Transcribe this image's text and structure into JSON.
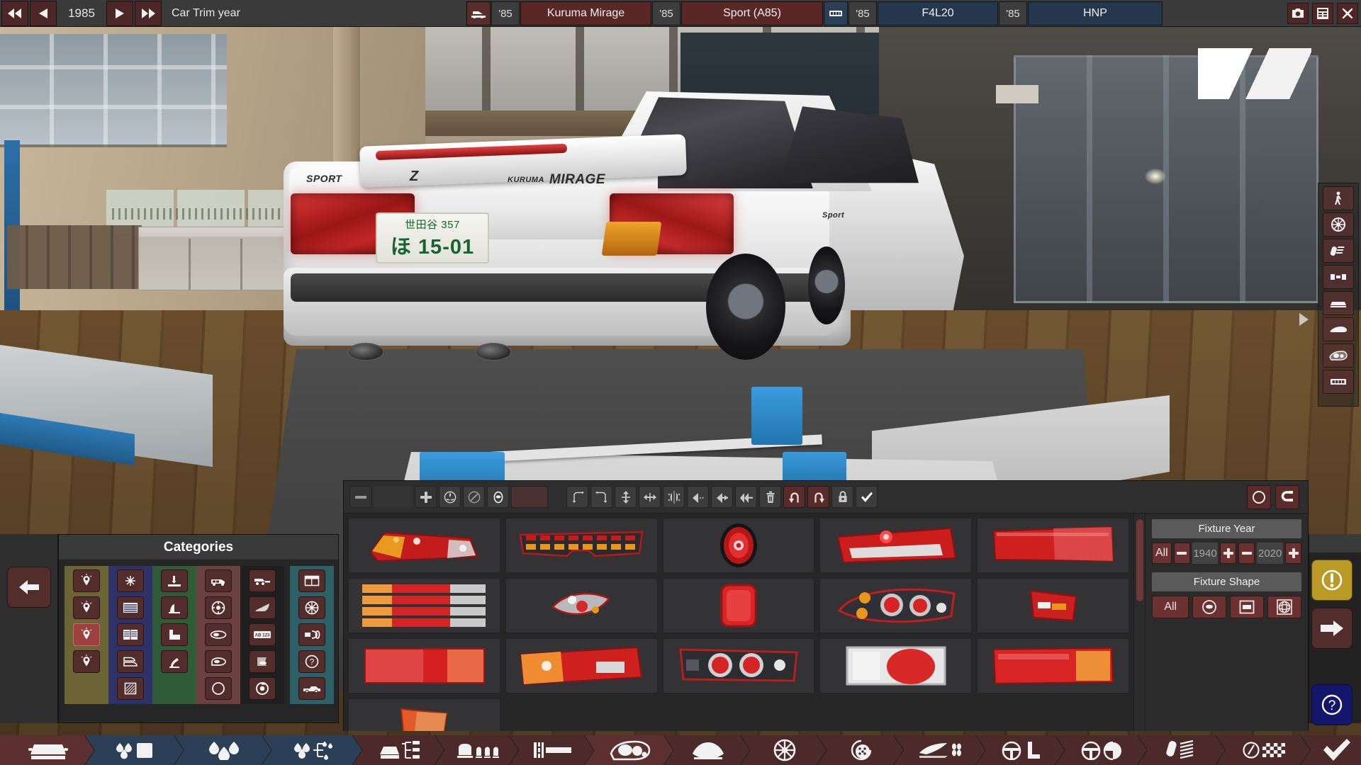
{
  "topbar": {
    "nav": {
      "prev_fast": "rewind-icon",
      "prev": "step-back-icon",
      "year": "1985",
      "next": "step-forward-icon",
      "next_fast": "fast-forward-icon"
    },
    "mode_label": "Car Trim year",
    "breadcrumbs": [
      {
        "icon": "car-icon",
        "year": "'85",
        "name": "Kuruma Mirage",
        "color": "red"
      },
      {
        "icon": "",
        "year": "'85",
        "name": "Sport (A85)",
        "color": "red"
      },
      {
        "icon": "engine-block-icon",
        "year": "'85",
        "name": "F4L20",
        "color": "blue"
      },
      {
        "icon": "",
        "year": "'85",
        "name": "HNP",
        "color": "blue"
      }
    ],
    "window_buttons": [
      {
        "name": "screenshot-button",
        "icon": "camera-icon"
      },
      {
        "name": "report-button",
        "icon": "table-icon"
      },
      {
        "name": "close-button",
        "icon": "close-icon"
      }
    ]
  },
  "viewport": {
    "license_plate": {
      "top": "世田谷 357",
      "bottom": "ほ 15-01"
    },
    "car_badges": {
      "left": "SPORT",
      "center": "Z",
      "right_small": "KURUMA",
      "right_big": "MIRAGE",
      "fender": "Sport"
    }
  },
  "vertical_strip": {
    "items": [
      {
        "name": "pedestrian-scale-icon",
        "label": "pedestrian-icon"
      },
      {
        "name": "wheel-view-icon",
        "label": "wheel-icon"
      },
      {
        "name": "suspension-view-icon",
        "label": "suspension-icon"
      },
      {
        "name": "chassis-view-icon",
        "label": "chassis-icon"
      },
      {
        "name": "front-view-icon",
        "label": "car-front-icon"
      },
      {
        "name": "side-view-icon",
        "label": "car-side-icon"
      },
      {
        "name": "lights-view-icon",
        "label": "headlight-icon"
      },
      {
        "name": "engine-view-icon",
        "label": "engine-icon"
      }
    ],
    "play_button": "play-icon"
  },
  "categories": {
    "title": "Categories",
    "prev_label": "prev-arrow",
    "columns": [
      {
        "color": "#6c6434",
        "items": [
          {
            "name": "light-round-icon",
            "active": false
          },
          {
            "name": "light-oval-icon",
            "active": false
          },
          {
            "name": "light-selected-icon",
            "active": true
          },
          {
            "name": "light-small-icon",
            "active": false
          }
        ]
      },
      {
        "color": "#2f3269",
        "items": [
          {
            "name": "grille-mesh-icon",
            "active": false
          },
          {
            "name": "grille-bars-icon",
            "active": false
          },
          {
            "name": "grille-double-icon",
            "active": false
          },
          {
            "name": "vent-icon",
            "active": false
          },
          {
            "name": "hatch-texture-icon",
            "active": false
          }
        ]
      },
      {
        "color": "#2f5b39",
        "items": [
          {
            "name": "spoiler-flat-icon",
            "active": false
          },
          {
            "name": "spoiler-lip-icon",
            "active": false
          },
          {
            "name": "spoiler-wing-icon",
            "active": false
          },
          {
            "name": "spoiler-duck-icon",
            "active": false
          }
        ]
      },
      {
        "color": "#6b4040",
        "items": [
          {
            "name": "roof-rack-icon",
            "active": false
          },
          {
            "name": "spare-wheel-icon",
            "active": false
          },
          {
            "name": "mirror-icon",
            "active": false
          },
          {
            "name": "mirror-wide-icon",
            "active": false
          },
          {
            "name": "circle-icon",
            "active": false
          }
        ]
      },
      {
        "color": "#1f1f1f",
        "items": [
          {
            "name": "tow-hook-icon",
            "active": false
          },
          {
            "name": "antenna-icon",
            "active": false
          },
          {
            "name": "license-plate-icon",
            "active": false,
            "label": "AB 123"
          },
          {
            "name": "flap-icon",
            "active": false
          },
          {
            "name": "fuel-cap-icon",
            "active": false
          }
        ]
      },
      {
        "color": "#2e6068",
        "items": [
          {
            "name": "window-icon",
            "active": false
          },
          {
            "name": "rim-icon",
            "active": false
          },
          {
            "name": "exhaust-icon",
            "active": false
          },
          {
            "name": "misc-question-icon",
            "active": false
          },
          {
            "name": "truck-icon",
            "active": false
          }
        ]
      }
    ]
  },
  "fixture_panel": {
    "toolbar": [
      {
        "name": "zoom-out-button",
        "icon": "minus-icon"
      },
      {
        "name": "size-field",
        "icon": "blank"
      },
      {
        "name": "zoom-in-button",
        "icon": "plus-icon"
      },
      {
        "name": "mirror-toggle-button",
        "icon": "mirror-icon"
      },
      {
        "name": "no-mirror-button",
        "icon": "no-mirror-icon"
      },
      {
        "name": "shape-oval-button",
        "icon": "oval-icon"
      },
      {
        "name": "color-swatch-button",
        "icon": "color-swatch"
      },
      {
        "name": "rotate-left-edge-button",
        "icon": "bend-left-icon"
      },
      {
        "name": "rotate-right-edge-button",
        "icon": "bend-right-icon"
      },
      {
        "name": "stretch-vertical-button",
        "icon": "arrows-vertical-icon"
      },
      {
        "name": "stretch-horizontal-button",
        "icon": "arrows-horizontal-icon"
      },
      {
        "name": "mirror-copy-button",
        "icon": "mirror-copy-icon"
      },
      {
        "name": "align-1-button",
        "icon": "align-dots-icon"
      },
      {
        "name": "align-2-button",
        "icon": "align-arrow-icon"
      },
      {
        "name": "align-3-button",
        "icon": "align-double-icon"
      },
      {
        "name": "delete-button",
        "icon": "trash-icon"
      },
      {
        "name": "undo-button",
        "icon": "undo-icon"
      },
      {
        "name": "redo-button",
        "icon": "redo-icon"
      },
      {
        "name": "lock-button",
        "icon": "lock-icon"
      },
      {
        "name": "confirm-button",
        "icon": "check-icon"
      }
    ],
    "toolbar_right": [
      {
        "name": "shape-circle-button",
        "icon": "circle-icon"
      },
      {
        "name": "magnet-button",
        "icon": "magnet-icon"
      }
    ],
    "grid_rows": 3,
    "grid_cols": 5,
    "fixture_year": {
      "title": "Fixture Year",
      "all_label": "All",
      "min": "1940",
      "max": "2020",
      "minus_label": "−",
      "plus_label": "+"
    },
    "fixture_shape": {
      "title": "Fixture Shape",
      "all_label": "All",
      "options": [
        {
          "name": "shape-oval-filter",
          "icon": "oval-icon"
        },
        {
          "name": "shape-rect-filter",
          "icon": "rect-icon"
        },
        {
          "name": "shape-sphere-filter",
          "icon": "sphere-icon"
        }
      ]
    }
  },
  "right_buttons": [
    {
      "name": "warning-button",
      "icon": "warning-icon",
      "color": "#b99a25"
    },
    {
      "name": "next-button",
      "icon": "right-arrow-icon",
      "color": "#532c2c"
    },
    {
      "name": "help-button",
      "icon": "question-icon",
      "color": "#14166b"
    }
  ],
  "taskbar": [
    {
      "name": "tab-body",
      "icon": "car-front-icon",
      "color": "red2",
      "active": true
    },
    {
      "name": "tab-paint",
      "icon": "paint-swatch-icon",
      "color": "blue"
    },
    {
      "name": "tab-colors",
      "icon": "paint-drops-icon",
      "color": "blue"
    },
    {
      "name": "tab-materials",
      "icon": "paint-tree-icon",
      "color": "blue"
    },
    {
      "name": "tab-body-parts",
      "icon": "car-parts-icon",
      "color": "red"
    },
    {
      "name": "tab-seats",
      "icon": "seats-icon",
      "color": "red"
    },
    {
      "name": "tab-grille",
      "icon": "grille-icon",
      "color": "red"
    },
    {
      "name": "tab-lights",
      "icon": "headlight-icon",
      "color": "red2",
      "active": true
    },
    {
      "name": "tab-engine-fan",
      "icon": "fan-icon",
      "color": "red"
    },
    {
      "name": "tab-wheels",
      "icon": "wheel-icon",
      "color": "red"
    },
    {
      "name": "tab-brakes",
      "icon": "brake-icon",
      "color": "red"
    },
    {
      "name": "tab-aero",
      "icon": "aero-icon",
      "color": "red"
    },
    {
      "name": "tab-steering",
      "icon": "steering-icon",
      "color": "red"
    },
    {
      "name": "tab-interior",
      "icon": "steering-interior-icon",
      "color": "red"
    },
    {
      "name": "tab-suspension",
      "icon": "suspension-icon",
      "color": "red"
    },
    {
      "name": "tab-testing",
      "icon": "gauge-flag-icon",
      "color": "red"
    },
    {
      "name": "tab-finish",
      "icon": "check-icon",
      "color": "red"
    }
  ]
}
